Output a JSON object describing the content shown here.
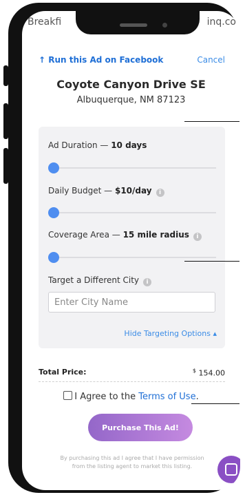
{
  "background_page": {
    "url_left": "Breakfi",
    "url_right": "inq.co"
  },
  "header": {
    "run_link": "Run this Ad on Facebook",
    "cancel": "Cancel",
    "title": "Coyote Canyon Drive SE",
    "subtitle": "Albuquerque, NM 87123"
  },
  "targeting": {
    "duration": {
      "label": "Ad Duration — ",
      "value": "10 days"
    },
    "budget": {
      "label": "Daily Budget — ",
      "value": "$10/day"
    },
    "coverage": {
      "label": "Coverage Area — ",
      "value": "15 mile radius"
    },
    "city": {
      "label": "Target a Different City",
      "placeholder": "Enter City Name"
    },
    "hide_link": "Hide Targeting Options ▴",
    "info_glyph": "i"
  },
  "total": {
    "label": "Total Price:",
    "currency": "$",
    "value": "154.00"
  },
  "agree": {
    "text": "I Agree to the ",
    "terms_link": "Terms of Use",
    "end": "."
  },
  "purchase_button": "Purchase This Ad!",
  "disclaimer": "By purchasing this ad I agree that I have permission from the listing agent to market this listing.",
  "colors": {
    "accent_blue": "#1f6fd6",
    "slider_thumb": "#4f8ef0",
    "purchase_gradient_start": "#9467c9",
    "purchase_gradient_end": "#c58ae0",
    "chat_button": "#8a4fc4"
  },
  "icons": [
    "arrow-up-icon",
    "info-icon",
    "chevron-up-icon",
    "checkbox-icon",
    "chat-icon"
  ]
}
